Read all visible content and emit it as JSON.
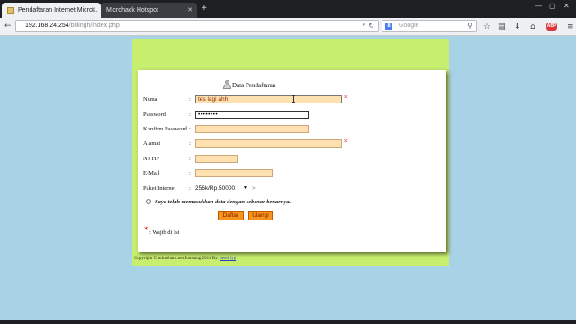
{
  "browser": {
    "tabs": [
      {
        "label": "Pendaftaran Internet Micro...",
        "active": true
      },
      {
        "label": "Microhack Hotspot",
        "active": false
      }
    ],
    "url_host": "192.168.24.254",
    "url_path": "/billingh/index.php",
    "search_placeholder": "Google",
    "search_engine_letter": "8",
    "addon_badge": "ABP"
  },
  "form": {
    "heading": "Data Pendaftaran",
    "fields": {
      "nama": {
        "label": "Nama",
        "value": "tes lagi ahh"
      },
      "password": {
        "label": "Password",
        "value": "••••••••"
      },
      "konfirm": {
        "label": "Konfirm Password",
        "value": ""
      },
      "alamat": {
        "label": "Alamat",
        "value": ""
      },
      "nohp": {
        "label": "No HP",
        "value": ""
      },
      "email": {
        "label": "E-Mail",
        "value": ""
      },
      "paket": {
        "label": "Paket Internet",
        "value": "256k/Rp.50000"
      }
    },
    "colon": ":",
    "required_mark": "*",
    "select_suffix": ">",
    "agreement": "Saya telah memasukkan data dengan sebenar benarnya.",
    "buttons": {
      "submit": "Daftar",
      "reset": "Ulangi"
    },
    "legend": ": Wajib di Isi"
  },
  "footer": {
    "text": "Copyright © microhack.net Jombang 2014 By: ",
    "link": "hendriyp"
  },
  "colors": {
    "page_bg": "#a8d2e5",
    "frame_bg": "#c7ee6e",
    "input_bg": "#ffe0b0",
    "button_bg": "#f7941d",
    "required": "#ee0000"
  }
}
